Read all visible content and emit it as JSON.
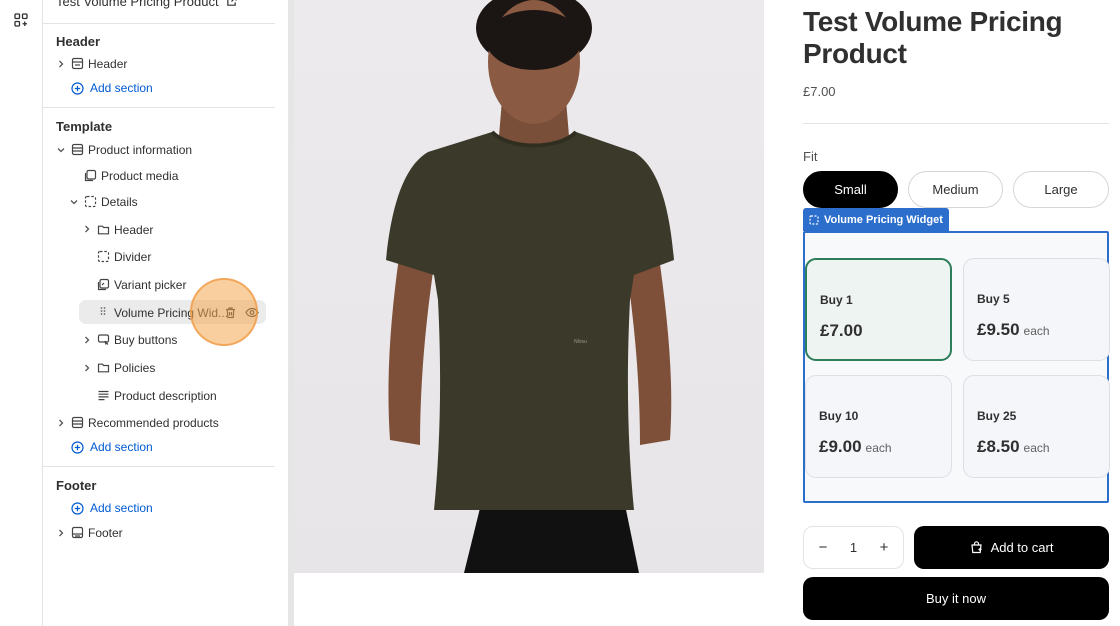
{
  "sidebar": {
    "page_title": "Test Volume Pricing Product",
    "header_group": {
      "title": "Header",
      "item": "Header",
      "add_section": "Add section"
    },
    "template_group": {
      "title": "Template",
      "product_information": "Product information",
      "product_media": "Product media",
      "details": "Details",
      "details_children": {
        "header": "Header",
        "divider": "Divider",
        "variant_picker": "Variant picker",
        "volume_pricing": "Volume Pricing Wid...",
        "buy_buttons": "Buy buttons",
        "policies": "Policies",
        "product_description": "Product description"
      },
      "recommended_products": "Recommended products",
      "add_section": "Add section"
    },
    "footer_group": {
      "title": "Footer",
      "add_section": "Add section",
      "item": "Footer"
    }
  },
  "product": {
    "title": "Test Volume Pricing Product",
    "price": "£7.00",
    "fit_label": "Fit",
    "fit_options": [
      "Small",
      "Medium",
      "Large"
    ],
    "fit_selected": "Small",
    "print_mark": "Nhisu"
  },
  "widget": {
    "tag_label": "Volume Pricing Widget",
    "tiers": [
      {
        "qty": "Buy 1",
        "price": "£7.00",
        "each": ""
      },
      {
        "qty": "Buy 5",
        "price": "£9.50",
        "each": "each"
      },
      {
        "qty": "Buy 10",
        "price": "£9.00",
        "each": "each"
      },
      {
        "qty": "Buy 25",
        "price": "£8.50",
        "each": "each"
      }
    ]
  },
  "purchase": {
    "quantity": "1",
    "minus": "−",
    "plus": "+",
    "add_to_cart": "Add to cart",
    "buy_now": "Buy it now"
  },
  "colors": {
    "accent_blue": "#2c6ecb",
    "link_blue": "#005bd3",
    "active_tier_border": "#2e7d5b",
    "button_black": "#000000"
  }
}
